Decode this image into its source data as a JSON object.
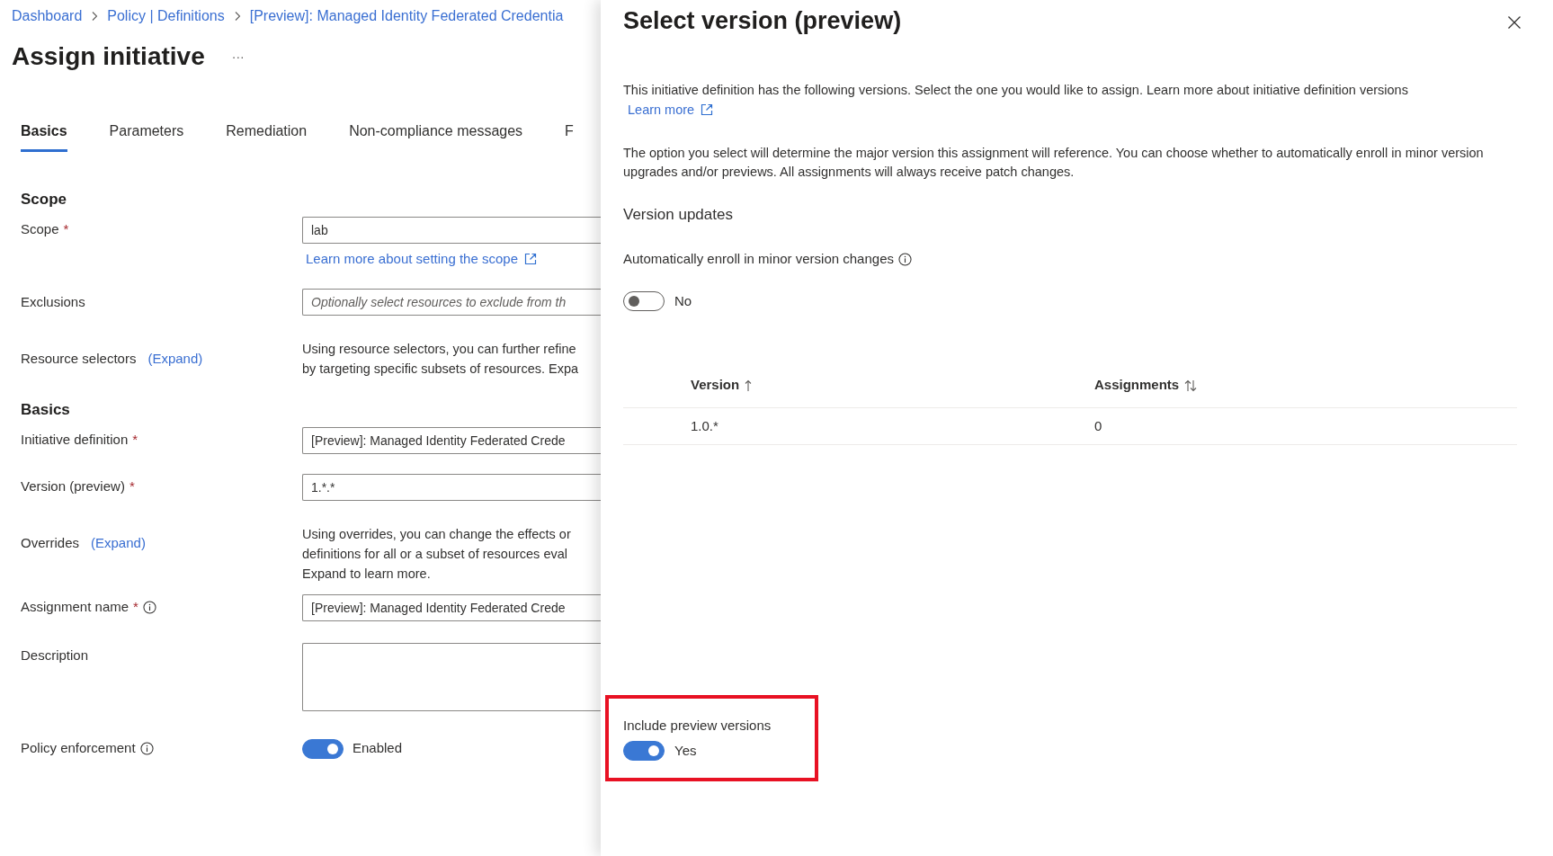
{
  "breadcrumb": [
    "Dashboard",
    "Policy | Definitions",
    "[Preview]: Managed Identity Federated Credentia"
  ],
  "page": {
    "title": "Assign initiative",
    "more": "···"
  },
  "tabs": [
    {
      "label": "Basics",
      "selected": true
    },
    {
      "label": "Parameters",
      "selected": false
    },
    {
      "label": "Remediation",
      "selected": false
    },
    {
      "label": "Non-compliance messages",
      "selected": false
    },
    {
      "label": "F",
      "selected": false
    }
  ],
  "form": [
    {
      "kind": "heading",
      "text": "Scope"
    },
    {
      "kind": "field",
      "label": "Scope",
      "required_mark": "*",
      "value": "lab",
      "link": "Learn more about setting the scope"
    },
    {
      "kind": "field",
      "label": "Exclusions",
      "placeholder": "Optionally select resources to exclude from th"
    },
    {
      "kind": "expand",
      "label": "Resource selectors",
      "expand": "(Expand)",
      "lines": [
        "Using resource selectors, you can further refine",
        "by targeting specific subsets of resources. Expa"
      ]
    },
    {
      "kind": "heading",
      "text": "Basics"
    },
    {
      "kind": "field",
      "label": "Initiative definition",
      "required_mark": "*",
      "value": "[Preview]: Managed Identity Federated Crede"
    },
    {
      "kind": "field",
      "label": "Version (preview)",
      "required_mark": "*",
      "value": "1.*.*"
    },
    {
      "kind": "expand",
      "label": "Overrides",
      "expand": "(Expand)",
      "lines": [
        "Using overrides, you can change the effects or",
        "definitions for all or a subset of resources eval",
        "Expand to learn more."
      ]
    },
    {
      "kind": "field",
      "label": "Assignment name",
      "required_mark": "*",
      "info": true,
      "value": "[Preview]: Managed Identity Federated Crede"
    },
    {
      "kind": "textarea",
      "label": "Description"
    },
    {
      "kind": "toggle",
      "label": "Policy enforcement",
      "info": true,
      "on": true,
      "state_text": "Enabled"
    }
  ],
  "panel": {
    "title": "Select version (preview)",
    "intro": "This initiative definition has the following versions. Select the one you would like to assign. Learn more about initiative definition versions",
    "intro_link": "Learn more",
    "note": "The option you select will determine the major version this assignment will reference. You can choose whether to automatically enroll in minor version upgrades and/or previews. All assignments will always receive patch changes.",
    "section": "Version updates",
    "auto_enroll": {
      "label": "Automatically enroll in minor version changes",
      "on": false,
      "state_text": "No"
    },
    "table": {
      "columns": [
        {
          "label": "Version",
          "kind": "sorted"
        },
        {
          "label": "Assignments",
          "kind": "sortable"
        }
      ],
      "rows": [
        [
          "1.0.*",
          "0"
        ]
      ]
    },
    "include_preview": {
      "label": "Include preview versions",
      "on": true,
      "state_text": "Yes",
      "highlighted": true
    }
  }
}
